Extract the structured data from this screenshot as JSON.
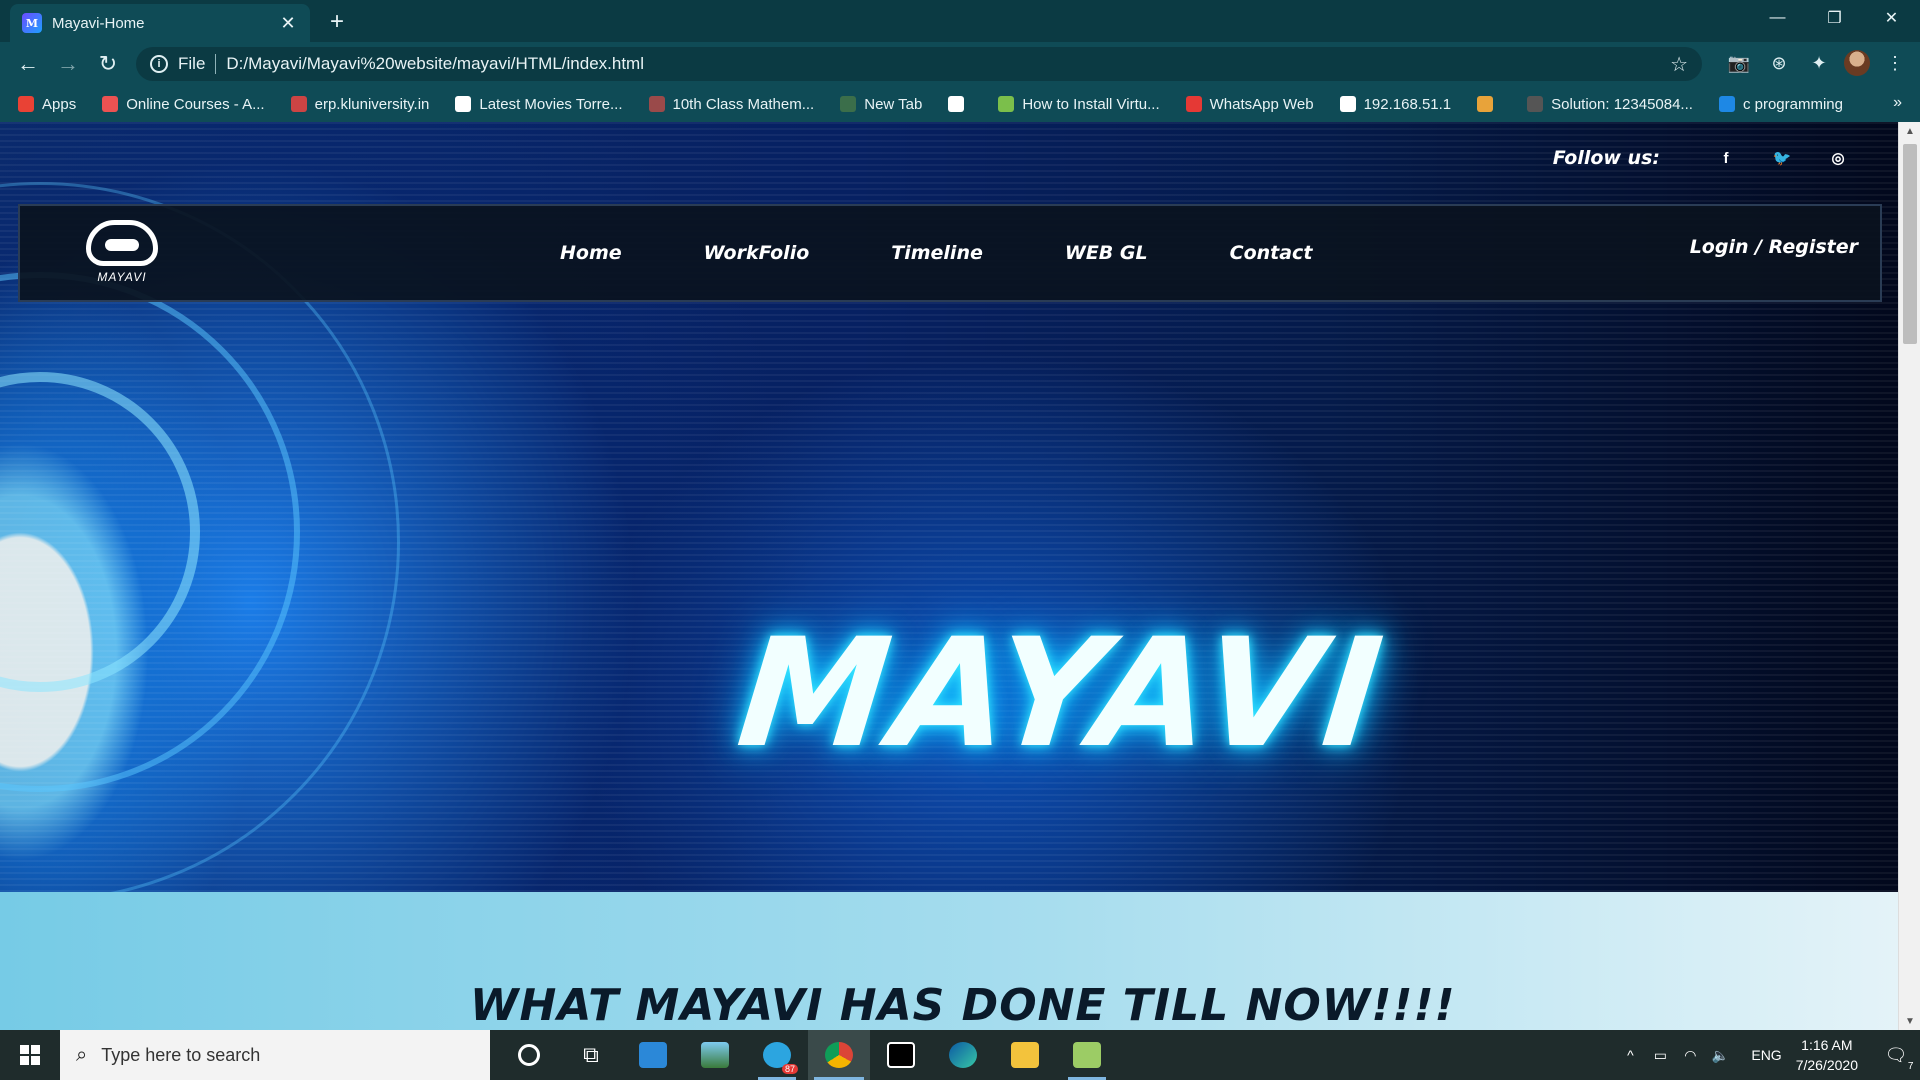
{
  "browser": {
    "tab": {
      "title": "Mayavi-Home",
      "close": "✕"
    },
    "new_tab": "+",
    "window_controls": {
      "minimize": "—",
      "restore": "❐",
      "close": "✕"
    },
    "omnibox": {
      "scheme": "File",
      "url": "D:/Mayavi/Mayavi%20website/mayavi/HTML/index.html"
    },
    "bookmarks": [
      {
        "label": "Apps",
        "icon": "apps-grid-icon",
        "color": "#e94235"
      },
      {
        "label": "Online Courses - A...",
        "icon": "udemy-icon",
        "color": "#ec5252"
      },
      {
        "label": "erp.kluniversity.in",
        "icon": "image-icon",
        "color": "#cc4444"
      },
      {
        "label": "Latest Movies Torre...",
        "icon": "globe-icon",
        "color": "#ffffff"
      },
      {
        "label": "10th Class Mathem...",
        "icon": "book-icon",
        "color": "#9a4a4a"
      },
      {
        "label": "New Tab",
        "icon": "new-tab-icon",
        "color": "#3b6e4a"
      },
      {
        "label": "",
        "icon": "globe-icon",
        "color": "#ffffff"
      },
      {
        "label": "How to Install Virtu...",
        "icon": "site-icon",
        "color": "#7bbf4b"
      },
      {
        "label": "WhatsApp Web",
        "icon": "alert-icon",
        "color": "#e53935"
      },
      {
        "label": "192.168.51.1",
        "icon": "globe-icon",
        "color": "#ffffff"
      },
      {
        "label": "",
        "icon": "in-icon",
        "color": "#e8a33a"
      },
      {
        "label": "Solution: 12345084...",
        "icon": "cc-icon",
        "color": "#555555"
      },
      {
        "label": "c programming",
        "icon": "c-icon",
        "color": "#1e88e5"
      }
    ],
    "bookmarks_more": "»"
  },
  "site": {
    "follow_label": "Follow us:",
    "social": [
      "f",
      "🐦",
      "◎"
    ],
    "logo_text": "MAYAVI",
    "nav": [
      "Home",
      "WorkFolio",
      "Timeline",
      "WEB GL",
      "Contact"
    ],
    "login": "Login / Register",
    "hero_title": "MAYAVI",
    "section_title": "WHAT MAYAVI HAS DONE TILL NOW!!!!"
  },
  "taskbar": {
    "search_placeholder": "Type here to search",
    "language": "ENG",
    "time": "1:16 AM",
    "date": "7/26/2020",
    "telegram_badge": "87",
    "notification_count": "7"
  }
}
